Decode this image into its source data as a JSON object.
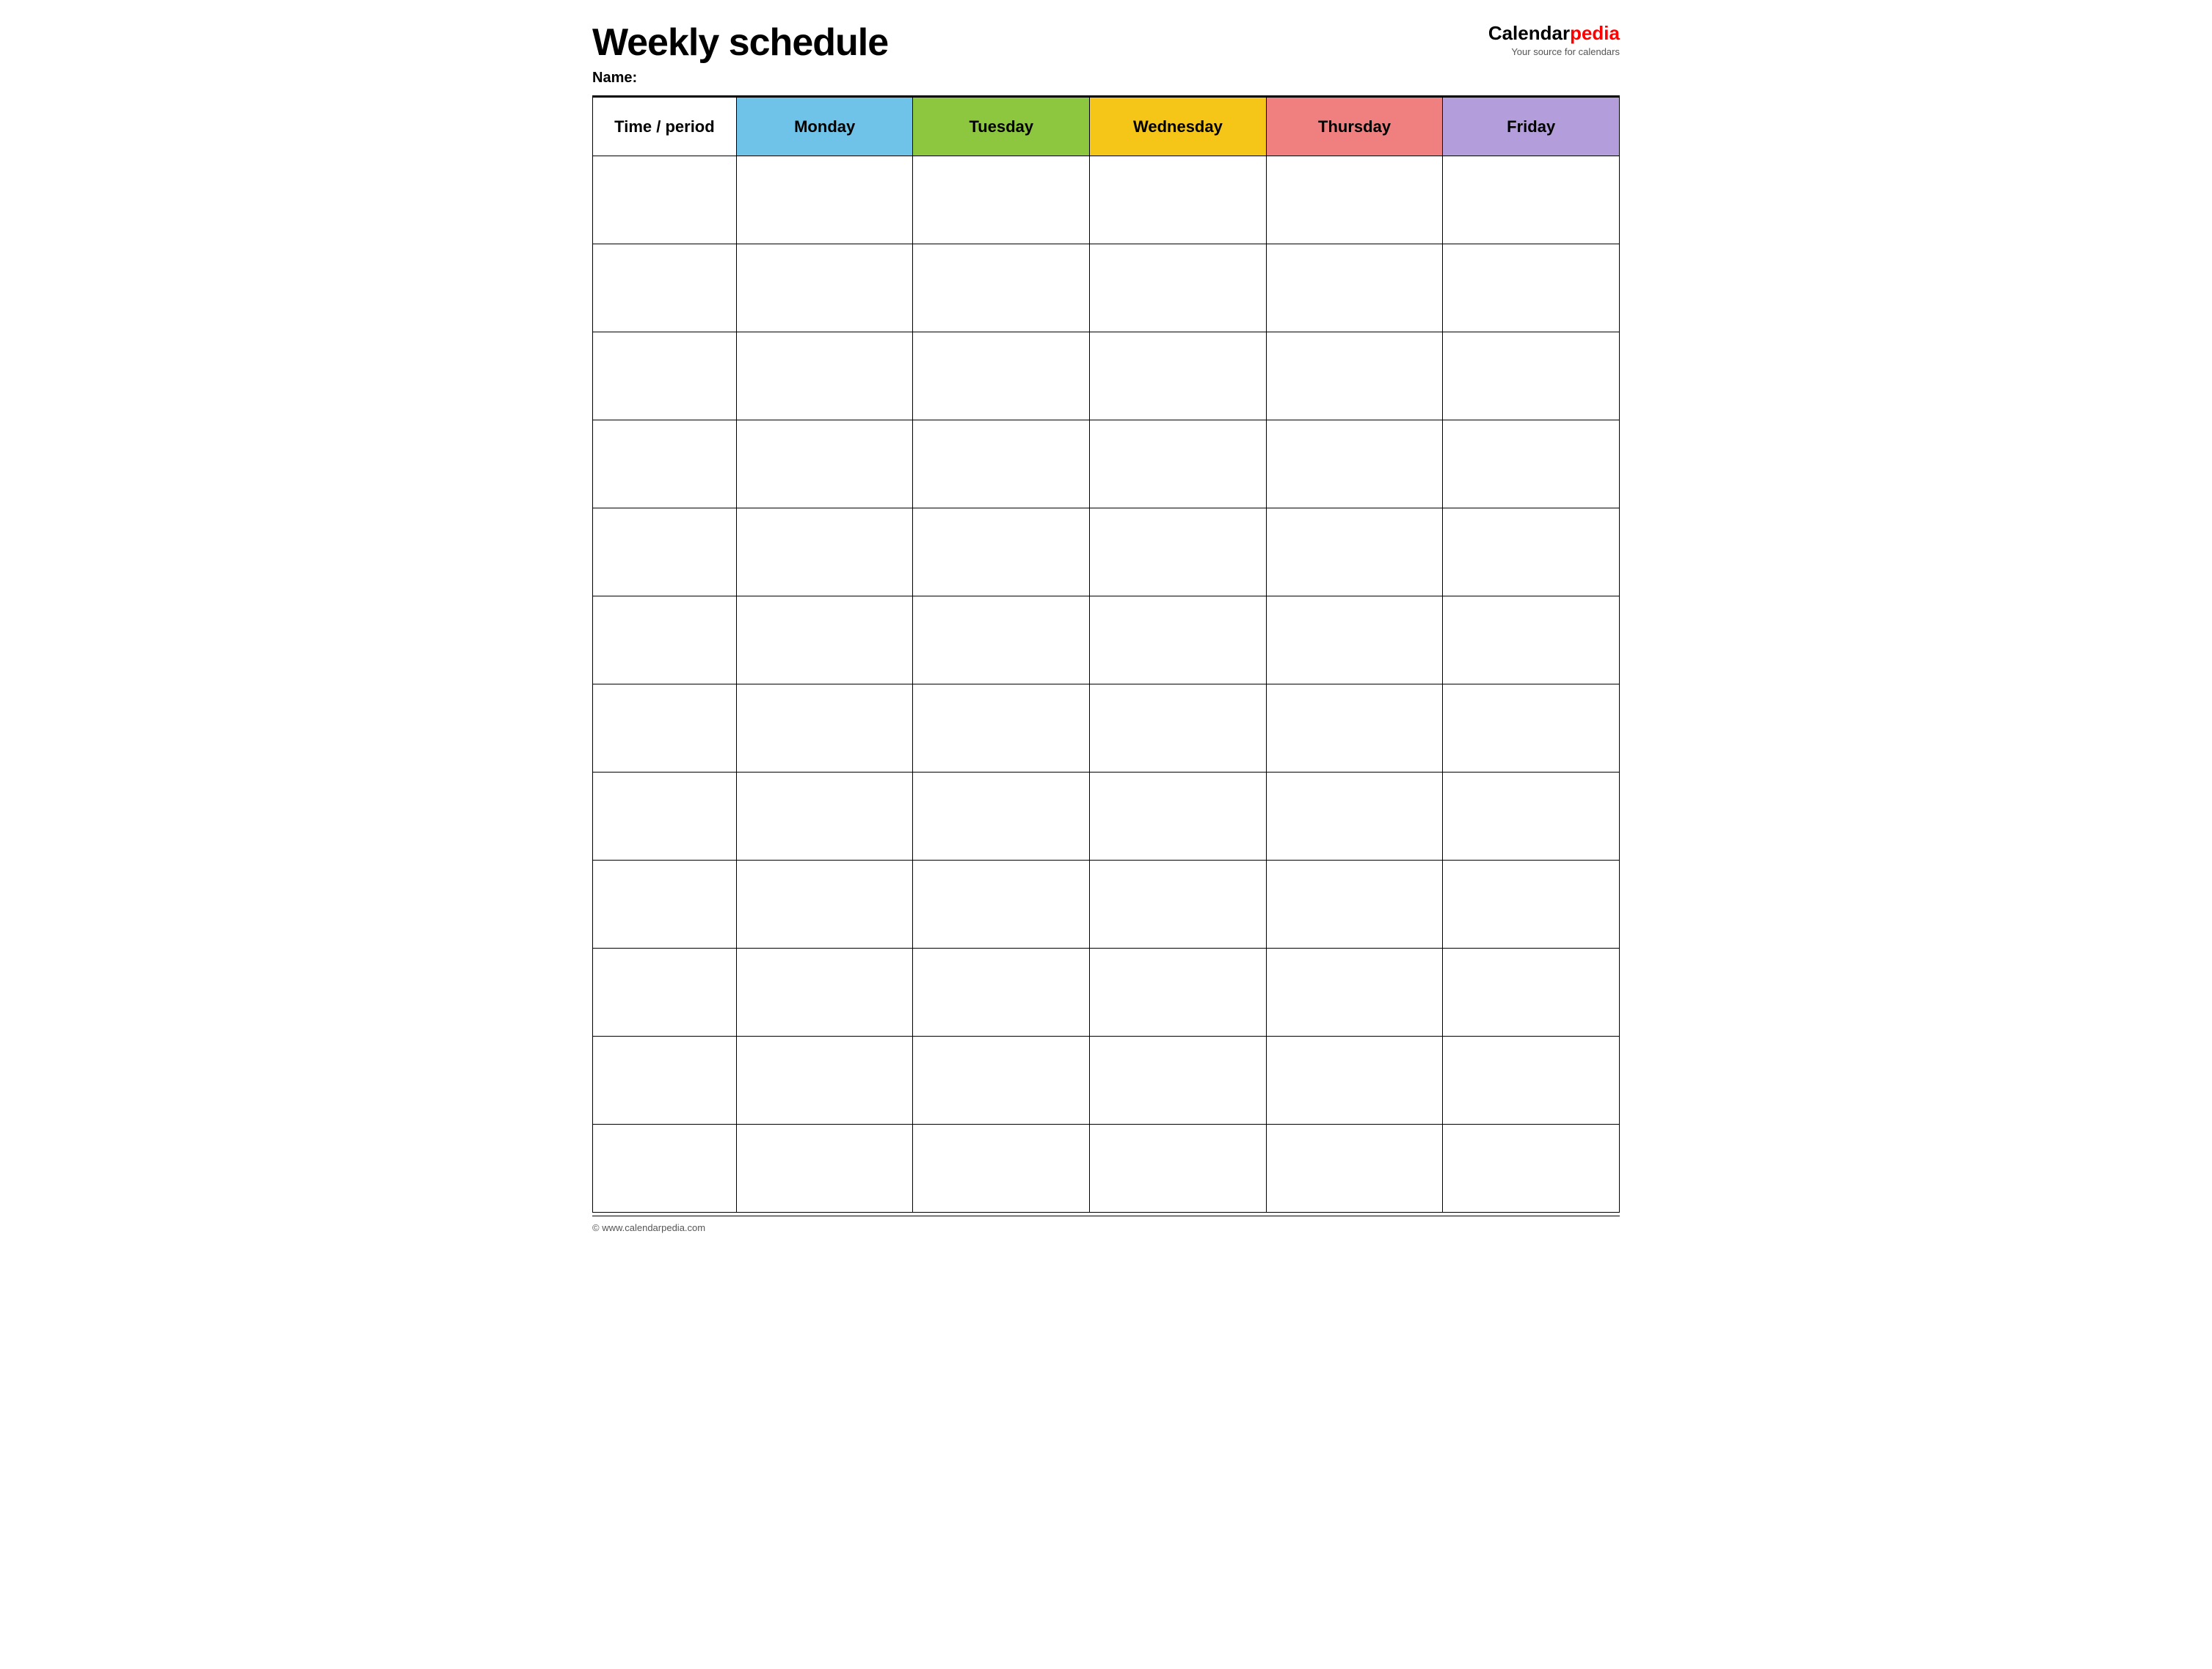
{
  "header": {
    "title": "Weekly schedule",
    "name_label": "Name:",
    "logo_calendar": "Calendar",
    "logo_pedia": "pedia",
    "logo_tagline": "Your source for calendars"
  },
  "table": {
    "columns": [
      {
        "label": "Time / period",
        "class": "col-time"
      },
      {
        "label": "Monday",
        "class": "col-monday"
      },
      {
        "label": "Tuesday",
        "class": "col-tuesday"
      },
      {
        "label": "Wednesday",
        "class": "col-wednesday"
      },
      {
        "label": "Thursday",
        "class": "col-thursday"
      },
      {
        "label": "Friday",
        "class": "col-friday"
      }
    ],
    "row_count": 12
  },
  "footer": {
    "copyright": "© www.calendarpedia.com"
  }
}
